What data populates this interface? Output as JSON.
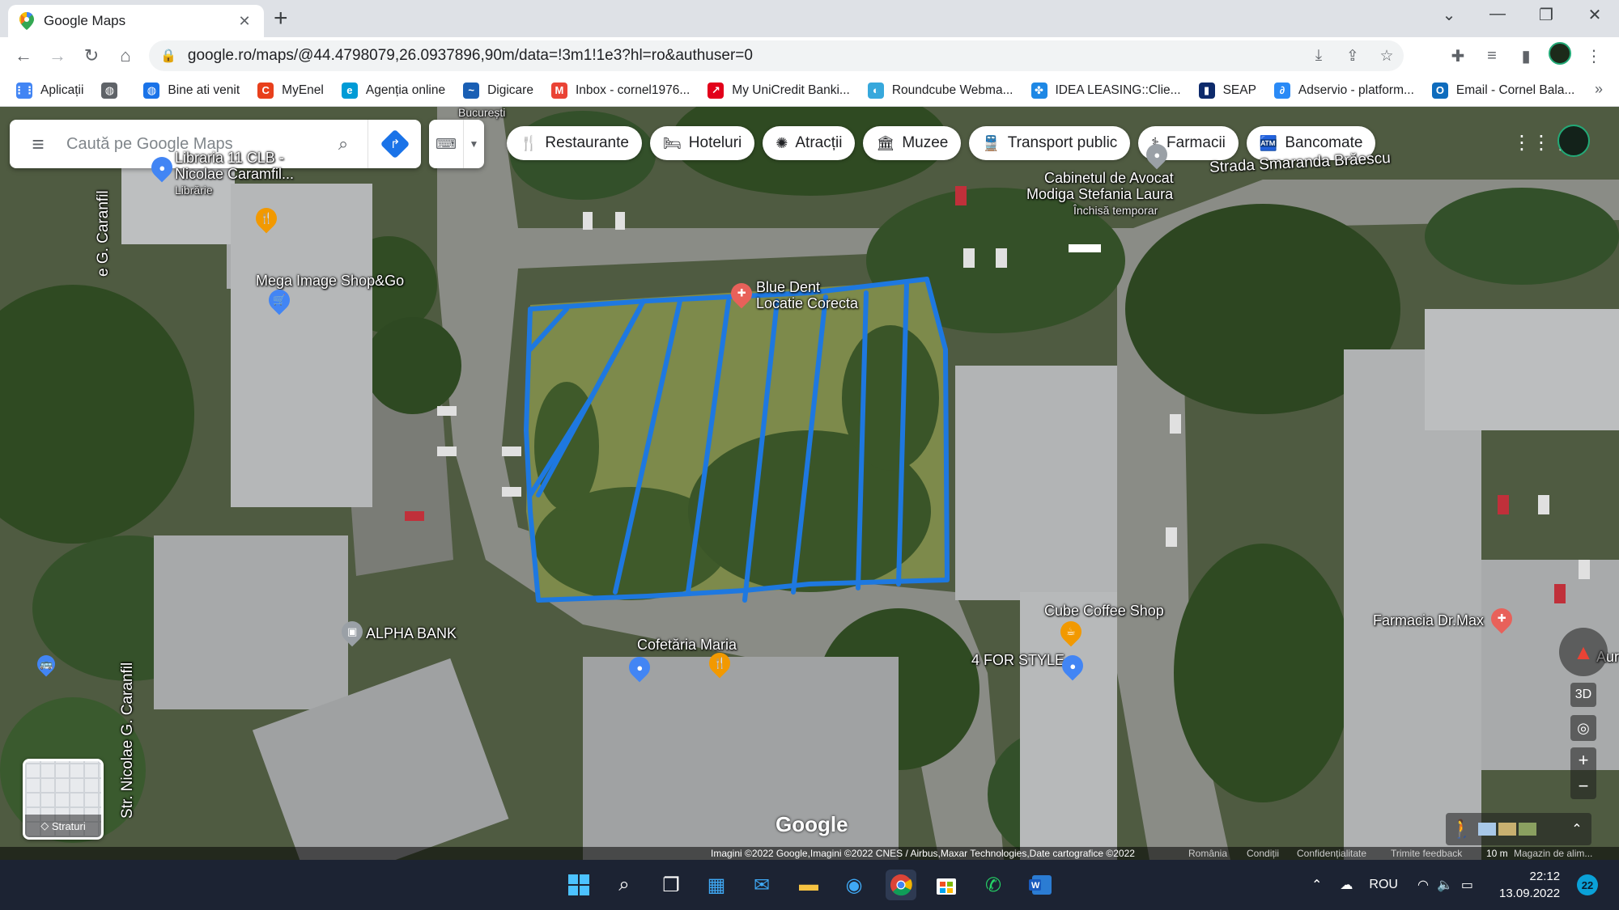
{
  "browser": {
    "tab_title": "Google Maps",
    "url": "google.ro/maps/@44.4798079,26.0937896,90m/data=!3m1!1e3?hl=ro&authuser=0"
  },
  "bookmarks": [
    {
      "label": "Aplicații",
      "icon": "apps-grid-icon",
      "color": "#4285f4"
    },
    {
      "label": "",
      "icon": "globe-icon",
      "color": "#5f6368"
    },
    {
      "label": "Bine ati venit",
      "icon": "globe-blue-icon",
      "color": "#1a73e8"
    },
    {
      "label": "MyEnel",
      "icon": "enel-icon",
      "color": "#e8401c"
    },
    {
      "label": "Agenția online",
      "icon": "agentie-icon",
      "color": "#009bd6"
    },
    {
      "label": "Digicare",
      "icon": "digi-icon",
      "color": "#1a5fb4"
    },
    {
      "label": "Inbox - cornel1976...",
      "icon": "gmail-icon",
      "color": "#ea4335"
    },
    {
      "label": "My UniCredit Banki...",
      "icon": "unicredit-icon",
      "color": "#e2001a"
    },
    {
      "label": "Roundcube Webma...",
      "icon": "roundcube-icon",
      "color": "#37a8dc"
    },
    {
      "label": "IDEA LEASING::Clie...",
      "icon": "idea-icon",
      "color": "#1e88e5"
    },
    {
      "label": "SEAP",
      "icon": "seap-icon",
      "color": "#0d2a6b"
    },
    {
      "label": "Adservio - platform...",
      "icon": "adservio-icon",
      "color": "#2a8af6"
    },
    {
      "label": "Email - Cornel Bala...",
      "icon": "outlook-icon",
      "color": "#0f6cbd"
    }
  ],
  "search": {
    "placeholder": "Caută pe Google Maps"
  },
  "chips": [
    {
      "label": "Restaurante",
      "icon": "fork-knife-icon",
      "glyph": "🍴"
    },
    {
      "label": "Hoteluri",
      "icon": "bed-icon",
      "glyph": "🛏"
    },
    {
      "label": "Atracții",
      "icon": "attraction-icon",
      "glyph": "✺"
    },
    {
      "label": "Muzee",
      "icon": "museum-icon",
      "glyph": "🏛"
    },
    {
      "label": "Transport public",
      "icon": "bus-icon",
      "glyph": "🚆"
    },
    {
      "label": "Farmacii",
      "icon": "pharmacy-icon",
      "glyph": "⚕"
    },
    {
      "label": "Bancomate",
      "icon": "atm-icon",
      "glyph": "🏧"
    }
  ],
  "map_labels": {
    "bucuresti": "București",
    "libraria": "Libraria 11 CLB -",
    "libraria2": "Nicolae Caramfil...",
    "libraria_type": "Librărie",
    "street_caranfil": "e G. Caranfil",
    "mega_image": "Mega Image Shop&Go",
    "blue_dent": "Blue Dent",
    "blue_dent2": "Locatie Corecta",
    "cabinet": "Cabinetul de Avocat",
    "cabinet2": "Modiga Stefania Laura",
    "cabinet_status": "Închisă temporar",
    "strada": "Strada Smaranda Brăescu",
    "str_nicolae": "Str. Nicolae G. Caranfil",
    "alpha_bank": "ALPHA BANK",
    "cofetaria": "Cofetăria Maria",
    "google": "Google",
    "for_style": "4 FOR STYLE",
    "cube_coffee": "Cube Coffee Shop",
    "farmacia": "Farmacia Dr.Max",
    "aur": "Aur",
    "layers": "Straturi",
    "three_d": "3D"
  },
  "attribution": {
    "imagery": "Imagini ©2022 Google,Imagini ©2022 CNES / Airbus,Maxar Technologies,Date cartografice ©2022",
    "country": "România",
    "terms": "Condiții",
    "privacy": "Confidențialitate",
    "feedback": "Trimite feedback",
    "scale": "10 m",
    "magazin": "Magazin de alim..."
  },
  "taskbar": {
    "language": "ROU",
    "time": "22:12",
    "date": "13.09.2022",
    "notifications": "22"
  }
}
